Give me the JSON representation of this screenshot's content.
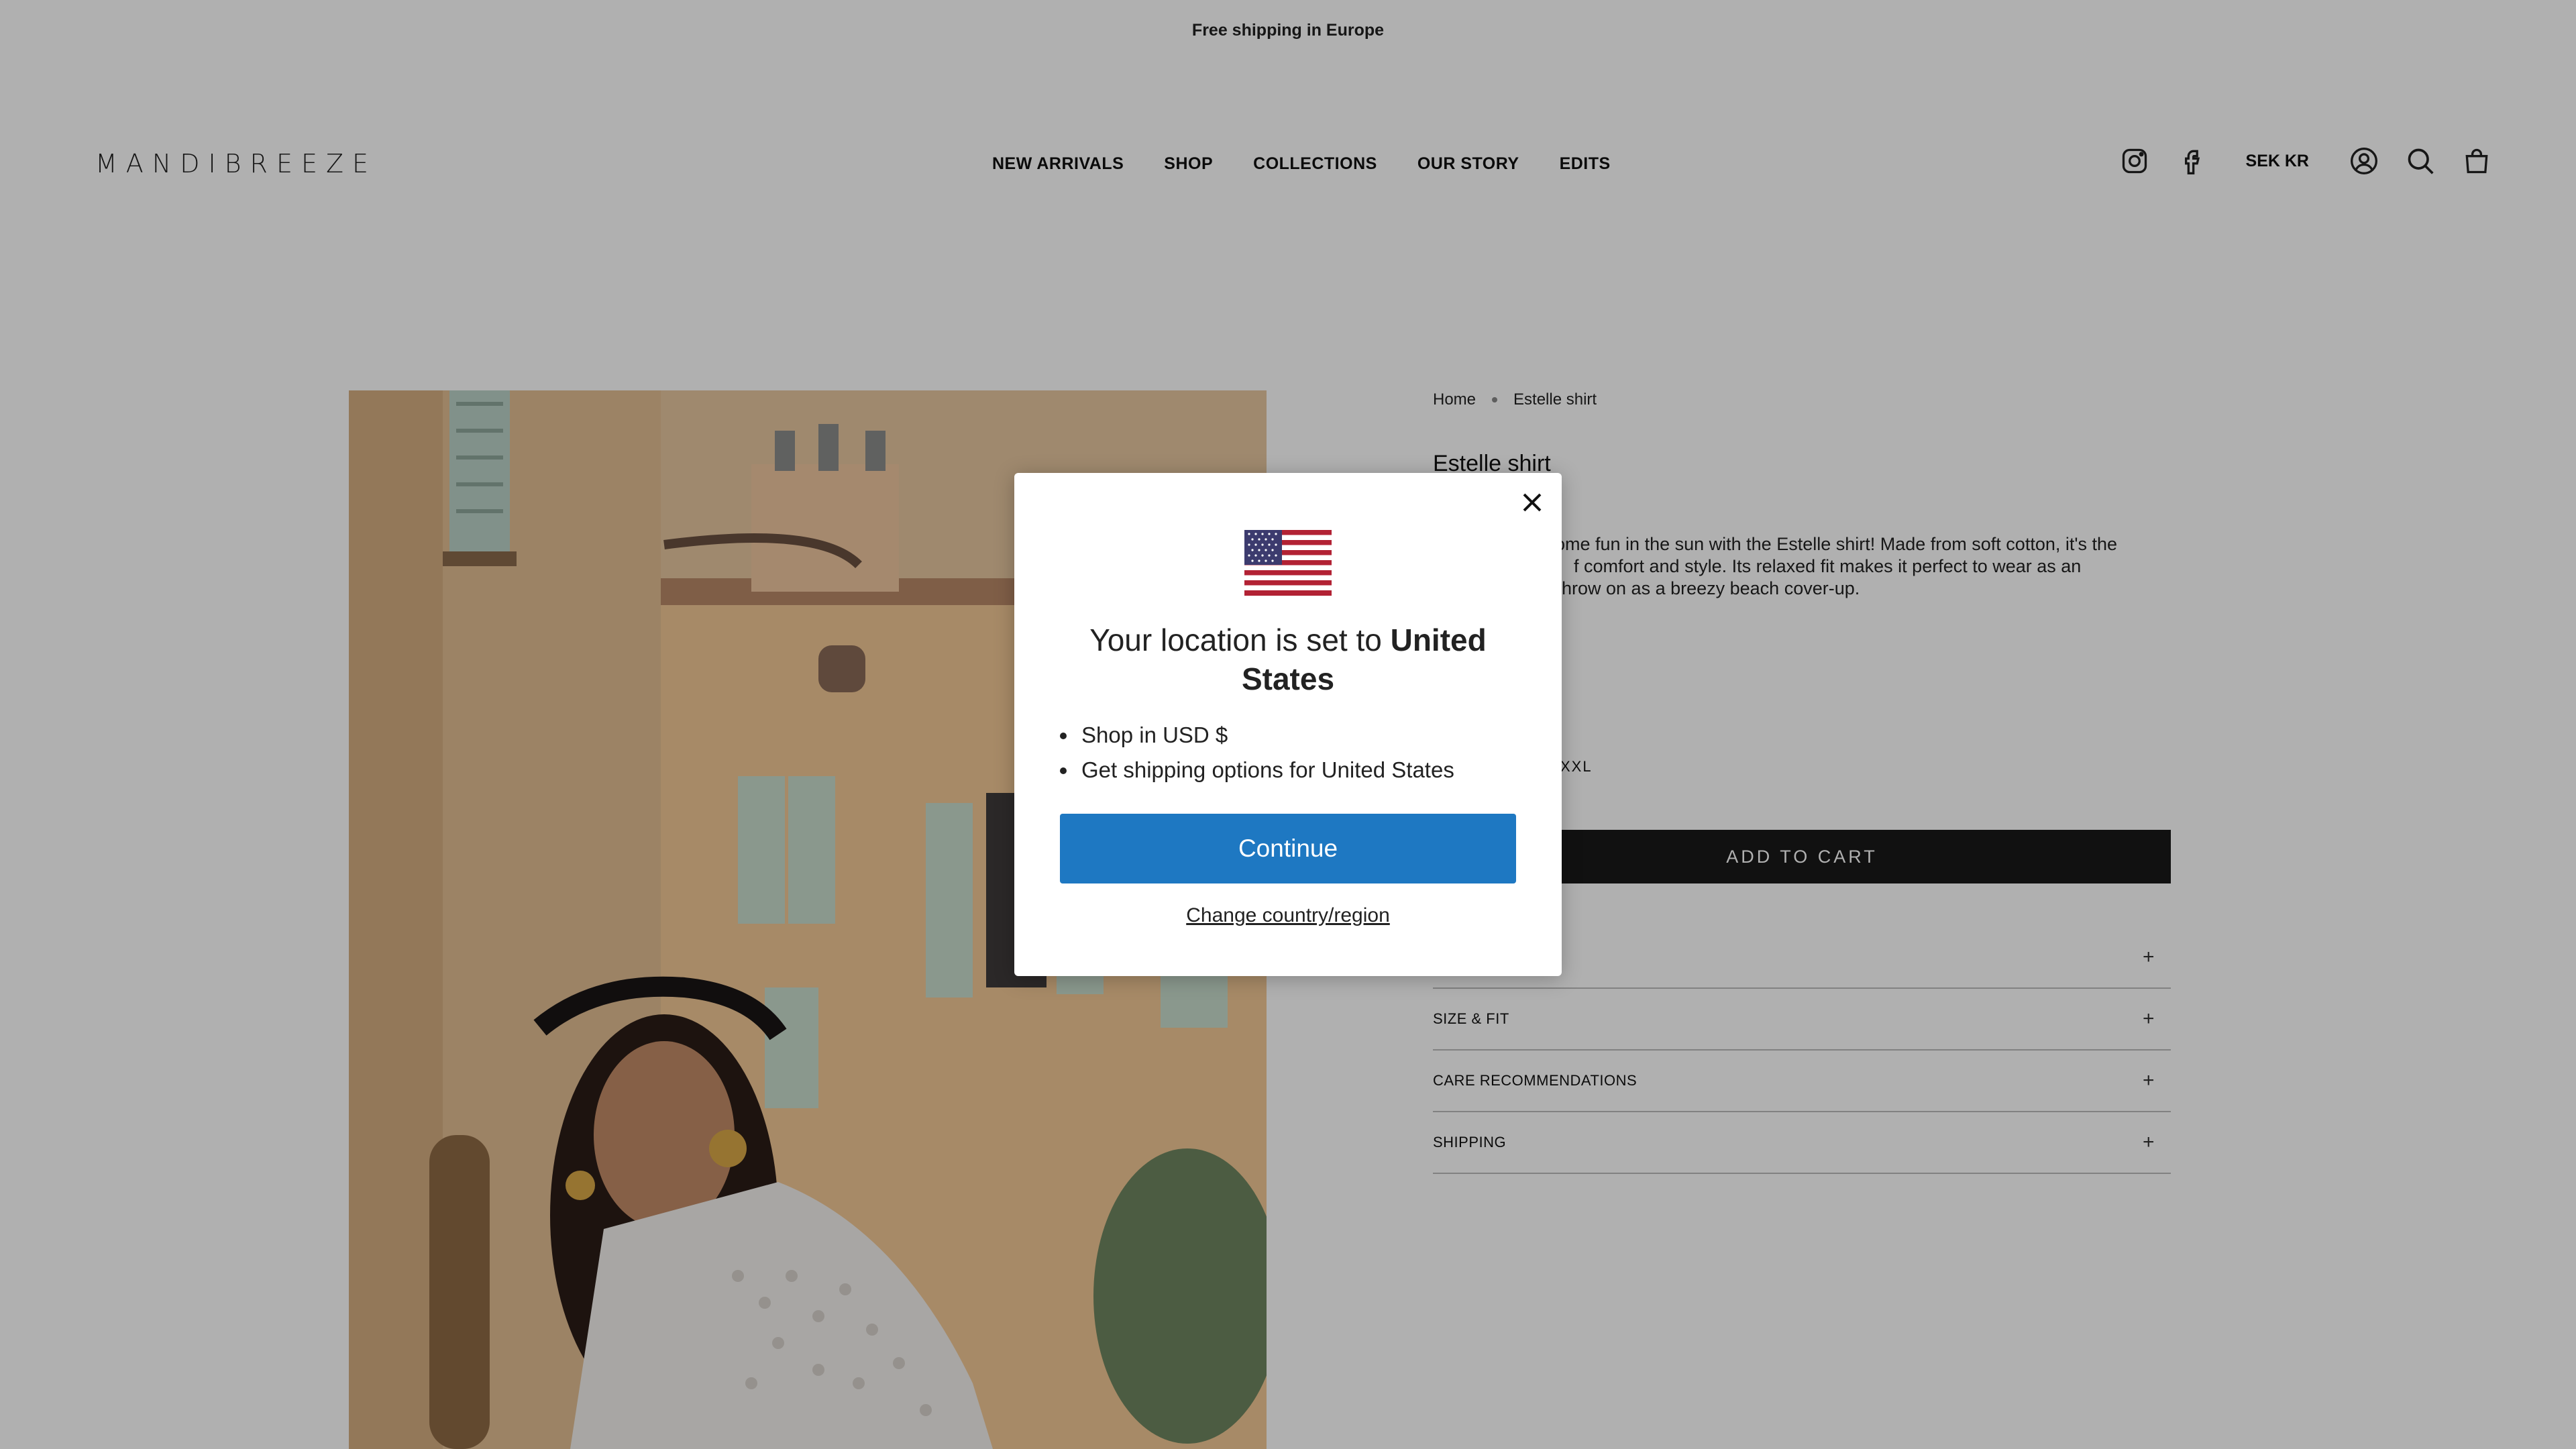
{
  "announcement": "Free shipping in Europe",
  "header": {
    "logo": "MANDIBREEZE",
    "nav": [
      "NEW ARRIVALS",
      "SHOP",
      "COLLECTIONS",
      "OUR STORY",
      "EDITS"
    ],
    "currency": "SEK KR",
    "icons": [
      "instagram-icon",
      "facebook-icon",
      "account-icon",
      "search-icon",
      "cart-icon"
    ]
  },
  "product": {
    "breadcrumb": [
      "Home",
      "Estelle shirt"
    ],
    "title": "Estelle shirt",
    "description": "ome fun in the sun with the Estelle shirt! Made from soft cotton, it's the f comfort and style. Its relaxed fit makes it perfect to wear as an hrow on as a breezy beach cover-up.",
    "desc_lines": [
      "ome fun in the sun with the Estelle shirt! Made from soft cotton, it's the",
      "f comfort and style. Its relaxed fit makes it perfect to wear as an",
      "hrow on as a breezy beach cover-up."
    ],
    "visible_size": "XXL",
    "add_to_cart": "ADD TO CART",
    "accordion": [
      "SIZE & FIT",
      "CARE RECOMMENDATIONS",
      "SHIPPING"
    ]
  },
  "modal": {
    "title_prefix": "Your location is set to ",
    "title_country": "United States",
    "bullets": [
      "Shop in USD $",
      "Get shipping options for United States"
    ],
    "continue": "Continue",
    "change": "Change country/region",
    "flag_icon": "us-flag-icon",
    "close_icon": "close-icon"
  },
  "colors": {
    "overlay": "#000000",
    "continue_bg": "#1e78c2",
    "add_to_cart_bg": "#1a1a1a"
  }
}
